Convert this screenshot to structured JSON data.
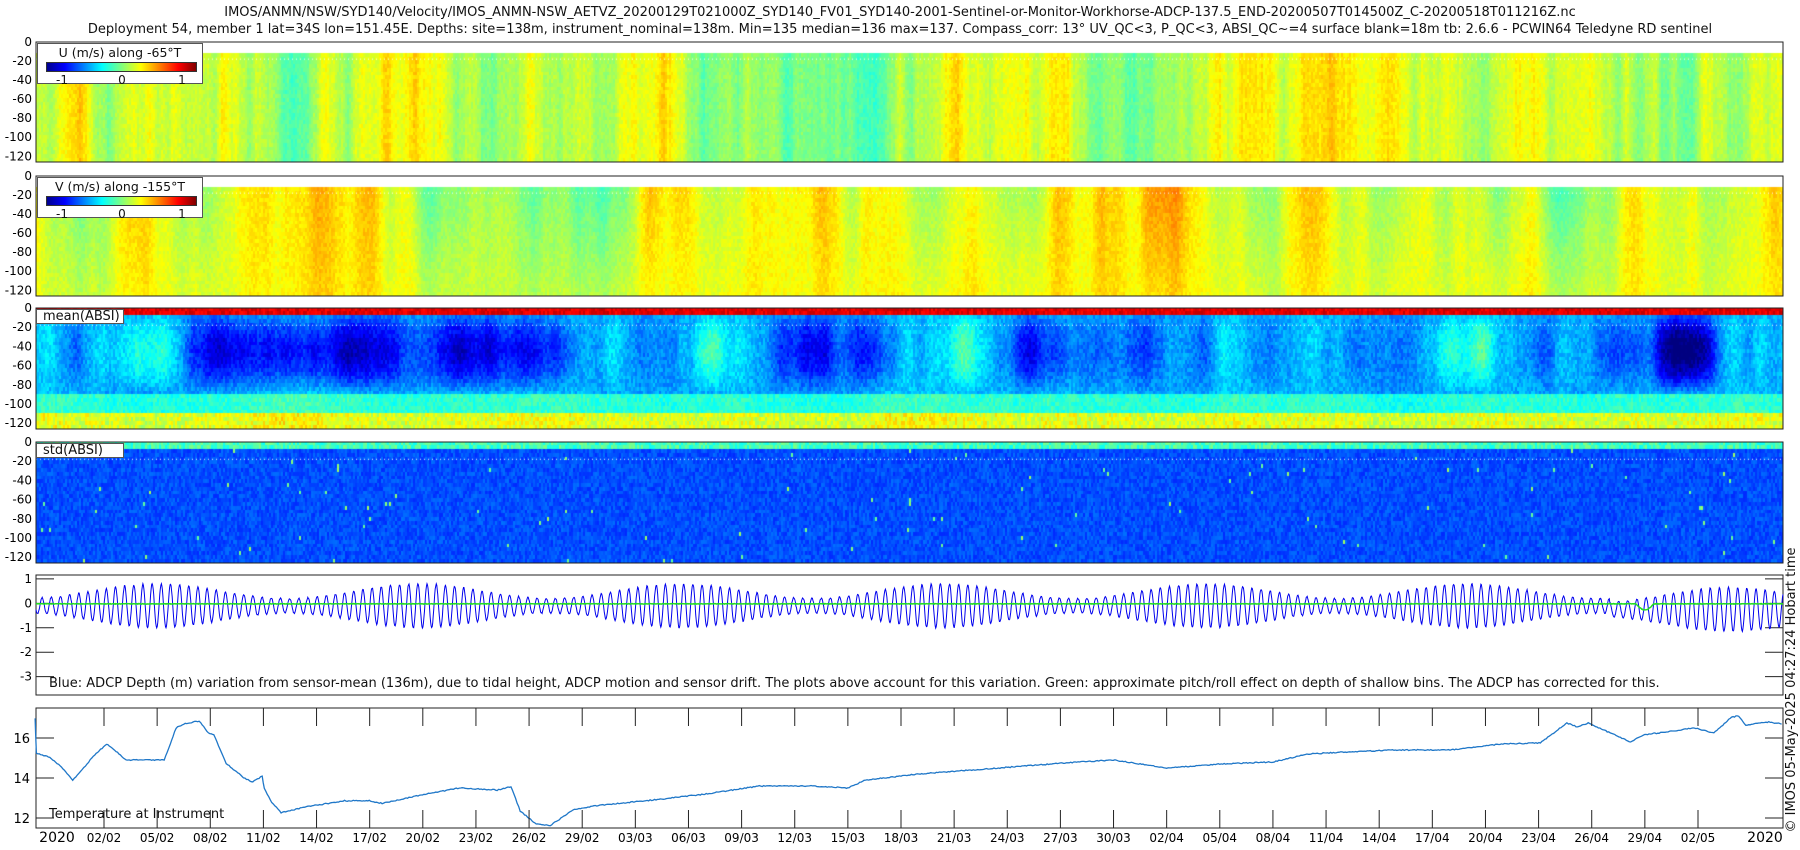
{
  "header": {
    "title_line1": "IMOS/ANMN/NSW/SYD140/Velocity/IMOS_ANMN-NSW_AETVZ_20200129T021000Z_SYD140_FV01_SYD140-2001-Sentinel-or-Monitor-Workhorse-ADCP-137.5_END-20200507T014500Z_C-20200518T011216Z.nc",
    "title_line2": "Deployment 54, member 1 lat=34S lon=151.45E. Depths: site=138m, instrument_nominal=138m. Min=135 median=136 max=137. Compass_corr: 13° UV_QC<3, P_QC<3, ABSI_QC~=4 surface blank=18m tb: 2.6.6 - PCWIN64 Teledyne RD sentinel"
  },
  "timestamp": "© IMOS 05-May-2025 04:27:24 Hobart time",
  "colors": {
    "depth_line": "#0000ee",
    "pitch_roll_line": "#22dd22",
    "temperature_line": "#1f77c8"
  },
  "chart_data": [
    {
      "type": "heatmap",
      "name": "u",
      "legend_title": "U (m/s) along -65°T",
      "colorbar_ticks": [
        "-1",
        "0",
        "1"
      ],
      "clim": [
        -1.25,
        1.25
      ],
      "ylim": [
        -126,
        0
      ],
      "yticks": [
        "0",
        "-20",
        "-40",
        "-60",
        "-80",
        "-100",
        "-120"
      ],
      "surface_blank_depth": -18
    },
    {
      "type": "heatmap",
      "name": "v",
      "legend_title": "V (m/s) along -155°T",
      "colorbar_ticks": [
        "-1",
        "0",
        "1"
      ],
      "clim": [
        -1.25,
        1.25
      ],
      "ylim": [
        -126,
        0
      ],
      "yticks": [
        "0",
        "-20",
        "-40",
        "-60",
        "-80",
        "-100",
        "-120"
      ],
      "surface_blank_depth": -18
    },
    {
      "type": "heatmap",
      "name": "mean_absi",
      "label": "mean(ABSI)",
      "ylim": [
        -126,
        0
      ],
      "yticks": [
        "0",
        "-20",
        "-40",
        "-60",
        "-80",
        "-100",
        "-120"
      ],
      "surface_blank_depth": -18
    },
    {
      "type": "heatmap",
      "name": "std_absi",
      "label": "std(ABSI)",
      "ylim": [
        -126,
        0
      ],
      "yticks": [
        "0",
        "-20",
        "-40",
        "-60",
        "-80",
        "-100",
        "-120"
      ],
      "surface_blank_depth": -18
    },
    {
      "type": "line",
      "name": "depth_variation",
      "note": "Blue: ADCP Depth (m) variation from sensor-mean (136m), due to tidal height, ADCP motion and sensor drift. The plots above account for this variation. Green: approximate pitch/roll effect on depth of shallow bins. The ADCP has corrected for this.",
      "ylim": [
        1.16,
        -3.75
      ],
      "yticks": [
        "1",
        "0",
        "-1",
        "-2",
        "-3"
      ],
      "ytick_values": [
        1,
        0,
        -1,
        -2,
        -3
      ],
      "tide_period_hours": 12.42,
      "amplitude_range_m": [
        0.3,
        0.9
      ],
      "spring_neap_period_days": 14.8
    },
    {
      "type": "line",
      "name": "temperature",
      "label": "Temperature at Instrument",
      "x_unit": "days from 02/02/2020",
      "ylim": [
        11.5,
        17.5
      ],
      "yticks": [
        "16",
        "14",
        "12"
      ],
      "ytick_values": [
        16,
        14,
        12
      ],
      "points": [
        [
          -3.89,
          17.0
        ],
        [
          -3.82,
          15.24
        ],
        [
          -3.06,
          15.03
        ],
        [
          -2.4,
          14.56
        ],
        [
          -1.77,
          13.9
        ],
        [
          -1.23,
          14.4
        ],
        [
          -0.69,
          15.0
        ],
        [
          0.14,
          15.7
        ],
        [
          0.6,
          15.4
        ],
        [
          1.25,
          14.9
        ],
        [
          2.77,
          14.9
        ],
        [
          3.4,
          14.9
        ],
        [
          4.07,
          16.5
        ],
        [
          4.5,
          16.7
        ],
        [
          5.37,
          16.85
        ],
        [
          5.9,
          16.25
        ],
        [
          6.2,
          16.15
        ],
        [
          6.9,
          14.73
        ],
        [
          7.96,
          13.97
        ],
        [
          8.4,
          13.8
        ],
        [
          8.93,
          14.1
        ],
        [
          9.05,
          13.46
        ],
        [
          9.47,
          12.78
        ],
        [
          10.0,
          12.27
        ],
        [
          11.42,
          12.56
        ],
        [
          13.58,
          12.86
        ],
        [
          14.98,
          12.86
        ],
        [
          15.7,
          12.73
        ],
        [
          17.9,
          13.15
        ],
        [
          20.06,
          13.5
        ],
        [
          22.2,
          13.4
        ],
        [
          22.98,
          13.57
        ],
        [
          23.5,
          12.35
        ],
        [
          24.4,
          11.7
        ],
        [
          25.2,
          11.63
        ],
        [
          26.56,
          12.44
        ],
        [
          28.0,
          12.64
        ],
        [
          31,
          12.9
        ],
        [
          34,
          13.2
        ],
        [
          37,
          13.6
        ],
        [
          40,
          13.6
        ],
        [
          42,
          13.5
        ],
        [
          43,
          13.9
        ],
        [
          46,
          14.2
        ],
        [
          49,
          14.4
        ],
        [
          52,
          14.6
        ],
        [
          55,
          14.8
        ],
        [
          57,
          14.9
        ],
        [
          60,
          14.5
        ],
        [
          63,
          14.7
        ],
        [
          66,
          14.8
        ],
        [
          68,
          15.2
        ],
        [
          70,
          15.3
        ],
        [
          73,
          15.4
        ],
        [
          76,
          15.4
        ],
        [
          78.9,
          15.7
        ],
        [
          81.1,
          15.75
        ],
        [
          82.6,
          16.75
        ],
        [
          83.2,
          16.55
        ],
        [
          83.8,
          16.75
        ],
        [
          86.2,
          15.8
        ],
        [
          86.9,
          16.15
        ],
        [
          89.8,
          16.5
        ],
        [
          90.9,
          16.25
        ],
        [
          91.9,
          17.05
        ],
        [
          92.3,
          17.1
        ],
        [
          92.7,
          16.65
        ],
        [
          94.0,
          16.8
        ],
        [
          94.8,
          16.7
        ]
      ]
    }
  ],
  "x_axis": {
    "xlim_days_from_0202": [
      -3.84,
      94.8
    ],
    "year_left": "2020",
    "year_right": "2020",
    "tick_labels": [
      "02/02",
      "05/02",
      "08/02",
      "11/02",
      "14/02",
      "17/02",
      "20/02",
      "23/02",
      "26/02",
      "29/02",
      "03/03",
      "06/03",
      "09/03",
      "12/03",
      "15/03",
      "18/03",
      "21/03",
      "24/03",
      "27/03",
      "30/03",
      "02/04",
      "05/04",
      "08/04",
      "11/04",
      "14/04",
      "17/04",
      "20/04",
      "23/04",
      "26/04",
      "29/04",
      "02/05"
    ],
    "tick_days": [
      0,
      3,
      6,
      9,
      12,
      15,
      18,
      21,
      24,
      27,
      30,
      33,
      36,
      39,
      42,
      45,
      48,
      51,
      54,
      57,
      60,
      63,
      66,
      69,
      72,
      75,
      78,
      81,
      84,
      87,
      90
    ]
  }
}
